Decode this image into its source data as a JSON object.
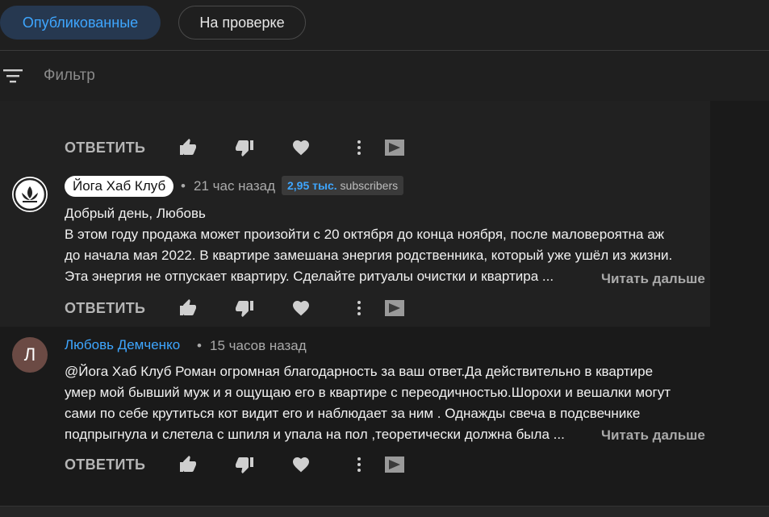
{
  "tabs": [
    {
      "label": "Опубликованные",
      "active": true
    },
    {
      "label": "На проверке",
      "active": false
    }
  ],
  "filter": {
    "placeholder": "Фильтр",
    "icon": "filter-icon"
  },
  "actions": {
    "reply_label": "ОТВЕТИТЬ"
  },
  "comments": [
    {
      "author": "Йога Хаб Клуб",
      "separator": "•",
      "time": "21 час назад",
      "subscribers_count": "2,95 тыс.",
      "subscribers_label": "subscribers",
      "lines": [
        "Добрый день, Любовь",
        "В этом году продажа может произойти с 20 октября до конца ноября, после маловероятна аж",
        "до начала мая 2022. В квартире замешана энергия родственника, который уже ушёл из жизни.",
        "Эта энергия не отпускает квартиру. Сделайте ритуалы очистки и квартира ..."
      ],
      "read_more": "Читать дальше"
    },
    {
      "author": "Любовь Демченко",
      "avatar_letter": "Л",
      "separator": "•",
      "time": "15 часов назад",
      "lines": [
        " @Йога Хаб Клуб  Роман огромная благодарность за ваш ответ.Да действительно в квартире",
        "умер мой бывший муж и я ощущаю его в квартире с переодичностью.Шорохи и вешалки могут",
        "сами по себе крутиться кот видит его и наблюдает за ним . Однажды свеча в подсвечнике",
        "подпрыгнула и слетела с шпиля и упала на пол ,теоретически должна была ..."
      ],
      "read_more": "Читать дальше"
    }
  ],
  "colors": {
    "accent": "#3ea6ff",
    "background": "#1f1f1f",
    "active_tab_bg": "#263850"
  }
}
